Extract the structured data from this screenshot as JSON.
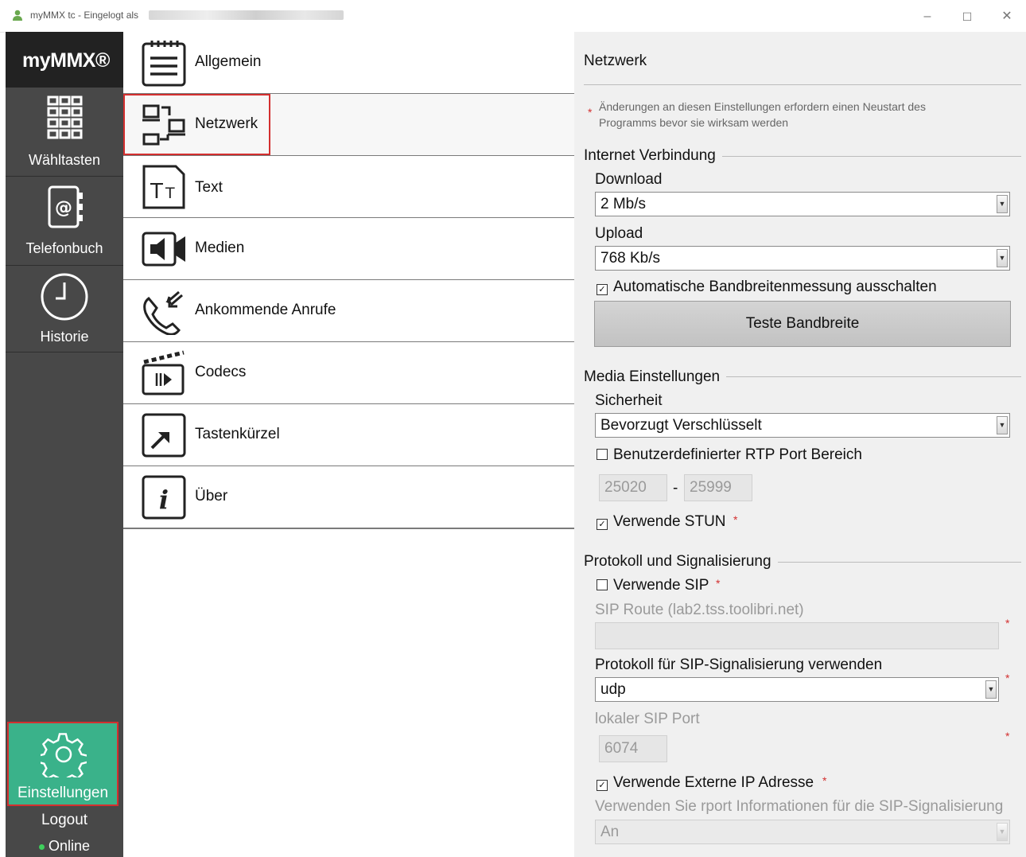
{
  "window": {
    "title": "myMMX tc - Eingelogt als",
    "controls": {
      "minimize": "–",
      "maximize": "☐",
      "close": "✕"
    }
  },
  "sidebar": {
    "logo": "myMMX®",
    "items": [
      {
        "label": "Wähltasten",
        "icon": "dialpad-icon"
      },
      {
        "label": "Telefonbuch",
        "icon": "phonebook-icon"
      },
      {
        "label": "Historie",
        "icon": "clock-icon"
      }
    ],
    "settings": {
      "label": "Einstellungen",
      "icon": "gear-icon",
      "active": true
    },
    "logout": "Logout",
    "status": "Online",
    "status_color": "#3ecf5c",
    "accent": "#3ab28a"
  },
  "menu": {
    "items": [
      {
        "label": "Allgemein",
        "icon": "document-icon"
      },
      {
        "label": "Netzwerk",
        "icon": "network-icon",
        "selected": true
      },
      {
        "label": "Text",
        "icon": "text-icon"
      },
      {
        "label": "Medien",
        "icon": "speaker-icon"
      },
      {
        "label": "Ankommende Anrufe",
        "icon": "incoming-call-icon"
      },
      {
        "label": "Codecs",
        "icon": "clapperboard-icon"
      },
      {
        "label": "Tastenkürzel",
        "icon": "shortcut-icon"
      },
      {
        "label": "Über",
        "icon": "info-icon"
      }
    ]
  },
  "panel": {
    "title": "Netzwerk",
    "notice": "Änderungen an diesen Einstellungen erfordern einen Neustart des Programms bevor sie wirksam werden",
    "notice_star": "*",
    "internet": {
      "section": "Internet Verbindung",
      "download_label": "Download",
      "download_value": "2 Mb/s",
      "upload_label": "Upload",
      "upload_value": "768 Kb/s",
      "auto_bandwidth_label": "Automatische Bandbreitenmessung ausschalten",
      "auto_bandwidth_checked": true,
      "test_button": "Teste Bandbreite"
    },
    "media": {
      "section": "Media Einstellungen",
      "security_label": "Sicherheit",
      "security_value": "Bevorzugt Verschlüsselt",
      "rtp_label": "Benutzerdefinierter RTP Port Bereich",
      "rtp_checked": false,
      "rtp_from": "25020",
      "rtp_sep": "-",
      "rtp_to": "25999",
      "stun_label": "Verwende STUN",
      "stun_checked": true
    },
    "protocol": {
      "section": "Protokoll und Signalisierung",
      "sip_label": "Verwende SIP",
      "sip_checked": false,
      "sip_route_label": "SIP Route (lab2.tss.toolibri.net)",
      "sip_route_value": "",
      "sig_protocol_label": "Protokoll für SIP-Signalisierung verwenden",
      "sig_protocol_value": "udp",
      "local_port_label": "lokaler SIP Port",
      "local_port_value": "6074",
      "ext_ip_label": "Verwende Externe IP Adresse",
      "ext_ip_checked": true,
      "rport_label": "Verwenden Sie rport Informationen für die SIP-Signalisierung",
      "rport_value": "An"
    },
    "star": "*",
    "checked_mark": "✓"
  }
}
